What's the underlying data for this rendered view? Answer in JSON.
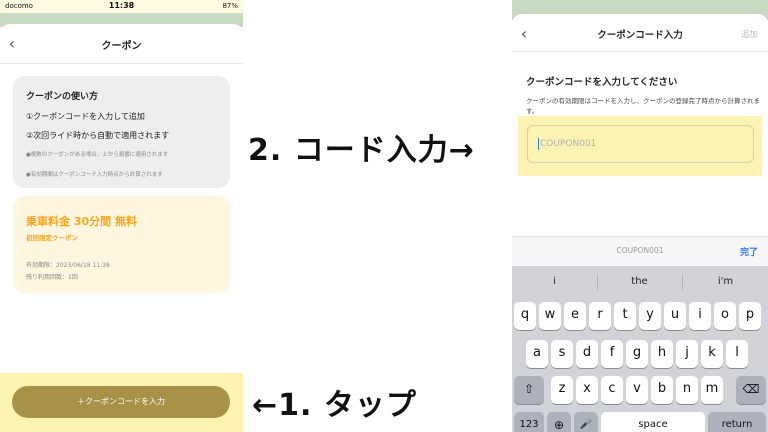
{
  "left_phone": {
    "status": {
      "carrier": "docomo",
      "time": "11:38",
      "battery": "87%"
    },
    "nav_title": "クーポン",
    "howto": {
      "title": "クーポンの使い方",
      "step1": "①クーポンコードを入力して追加",
      "step2": "②次回ライド時から自動で適用されます",
      "note1": "●複数のクーポンがある場合、上から順番に適用されます",
      "note2": "●有効期間はクーポンコード入力時点から計算されます"
    },
    "coupon": {
      "title": "乗車料金 30分間 無料",
      "subtitle": "初回限定クーポン",
      "expiry": "有効期限：2023/06/18 11:38",
      "uses_left": "残り利用回数：1回"
    },
    "enter_code_button": "＋クーポンコードを入力"
  },
  "annotations": {
    "step2": "2. コード入力→",
    "step1": "←1. タップ"
  },
  "right_phone": {
    "nav_title": "クーポンコード入力",
    "nav_add": "追加",
    "prompt_title": "クーポンコードを入力してください",
    "prompt_desc": "クーポンの有効期限はコードを入力し、クーポンの登録完了時点から計算されます。",
    "input_placeholder": "COUPON001",
    "accessory_text": "COUPON001",
    "done_label": "完了",
    "suggestions": [
      "i",
      "the",
      "i'm"
    ],
    "keys_row1": [
      "q",
      "w",
      "e",
      "r",
      "t",
      "y",
      "u",
      "i",
      "o",
      "p"
    ],
    "keys_row2": [
      "a",
      "s",
      "d",
      "f",
      "g",
      "h",
      "j",
      "k",
      "l"
    ],
    "keys_row3": [
      "z",
      "x",
      "c",
      "v",
      "b",
      "n",
      "m"
    ],
    "shift_glyph": "⇧",
    "delete_glyph": "⌫",
    "num_key": "123",
    "globe_glyph": "⊕",
    "mic_glyph": "🎤",
    "space_label": "space",
    "return_label": "return"
  }
}
